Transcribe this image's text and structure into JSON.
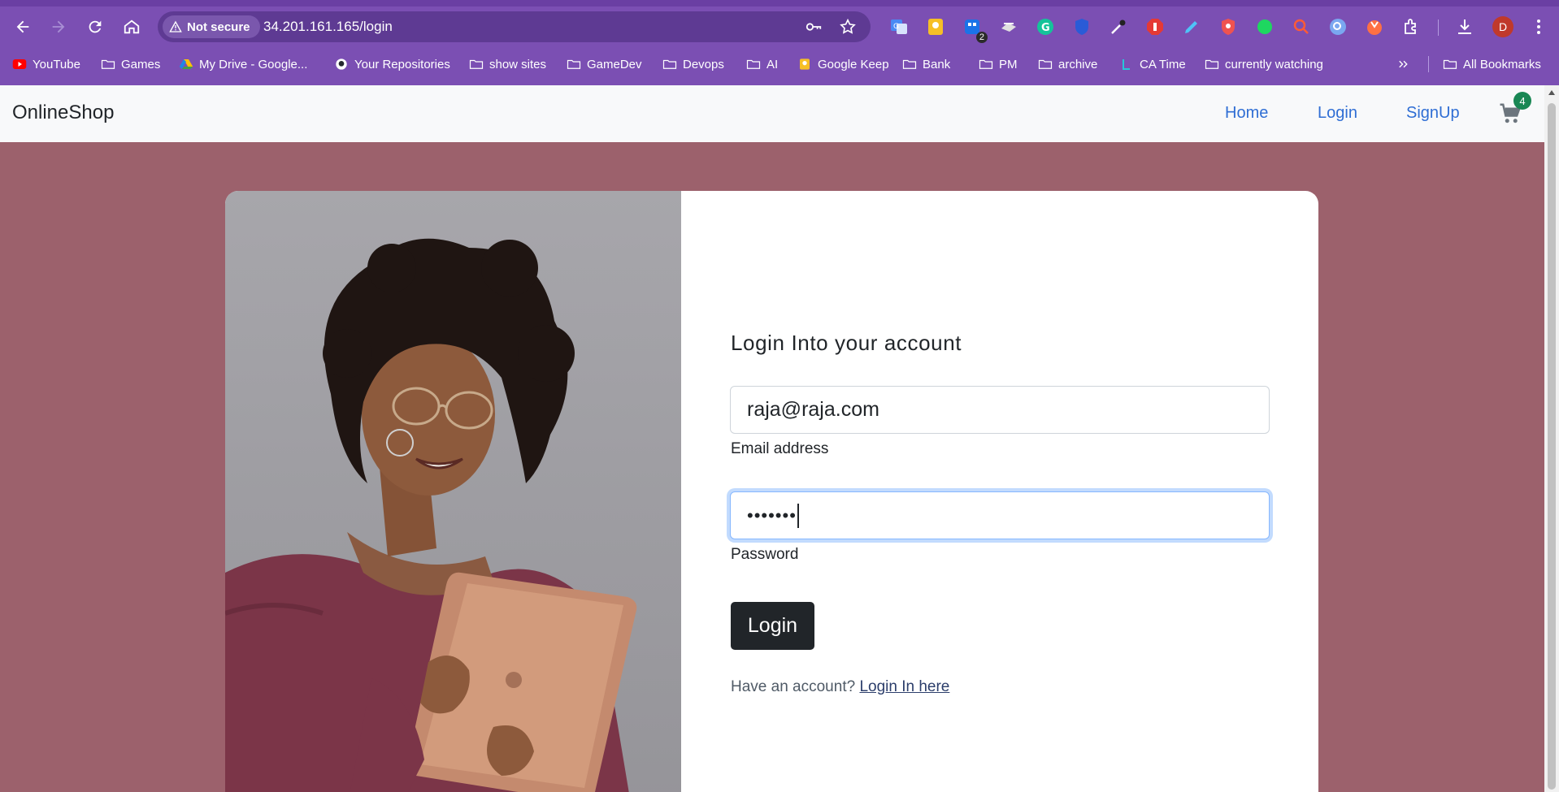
{
  "browser": {
    "security_label": "Not secure",
    "url": "34.201.161.165/login",
    "extension_badge": "2",
    "profile_initial": "D"
  },
  "bookmarks": {
    "items": [
      {
        "label": "YouTube",
        "icon": "youtube-icon"
      },
      {
        "label": "Games",
        "icon": "folder-icon"
      },
      {
        "label": "My Drive - Google...",
        "icon": "google-drive-icon"
      },
      {
        "label": "Your Repositories",
        "icon": "github-icon"
      },
      {
        "label": "show sites",
        "icon": "folder-icon"
      },
      {
        "label": "GameDev",
        "icon": "folder-icon"
      },
      {
        "label": "Devops",
        "icon": "folder-icon"
      },
      {
        "label": "AI",
        "icon": "folder-icon"
      },
      {
        "label": "Google Keep",
        "icon": "google-keep-icon"
      },
      {
        "label": "Bank",
        "icon": "folder-icon"
      },
      {
        "label": "PM",
        "icon": "folder-icon"
      },
      {
        "label": "archive",
        "icon": "folder-icon"
      },
      {
        "label": "CA Time",
        "icon": "ca-time-icon"
      },
      {
        "label": "currently watching",
        "icon": "folder-icon"
      }
    ],
    "all_bookmarks_label": "All Bookmarks"
  },
  "site": {
    "brand": "OnlineShop",
    "nav": {
      "home": "Home",
      "login": "Login",
      "signup": "SignUp"
    },
    "cart_count": "4"
  },
  "login_form": {
    "title": "Login Into your account",
    "email_value": "raja@raja.com",
    "email_label": "Email address",
    "password_value": "•••••••",
    "password_label": "Password",
    "submit_label": "Login",
    "footer_prompt": "Have an account?",
    "footer_link": "Login In here"
  },
  "colors": {
    "chrome": "#7b4fb3",
    "page_background": "#9c616c",
    "link_blue": "#2f6ed4",
    "button_dark": "#212529",
    "badge_green": "#198754"
  }
}
